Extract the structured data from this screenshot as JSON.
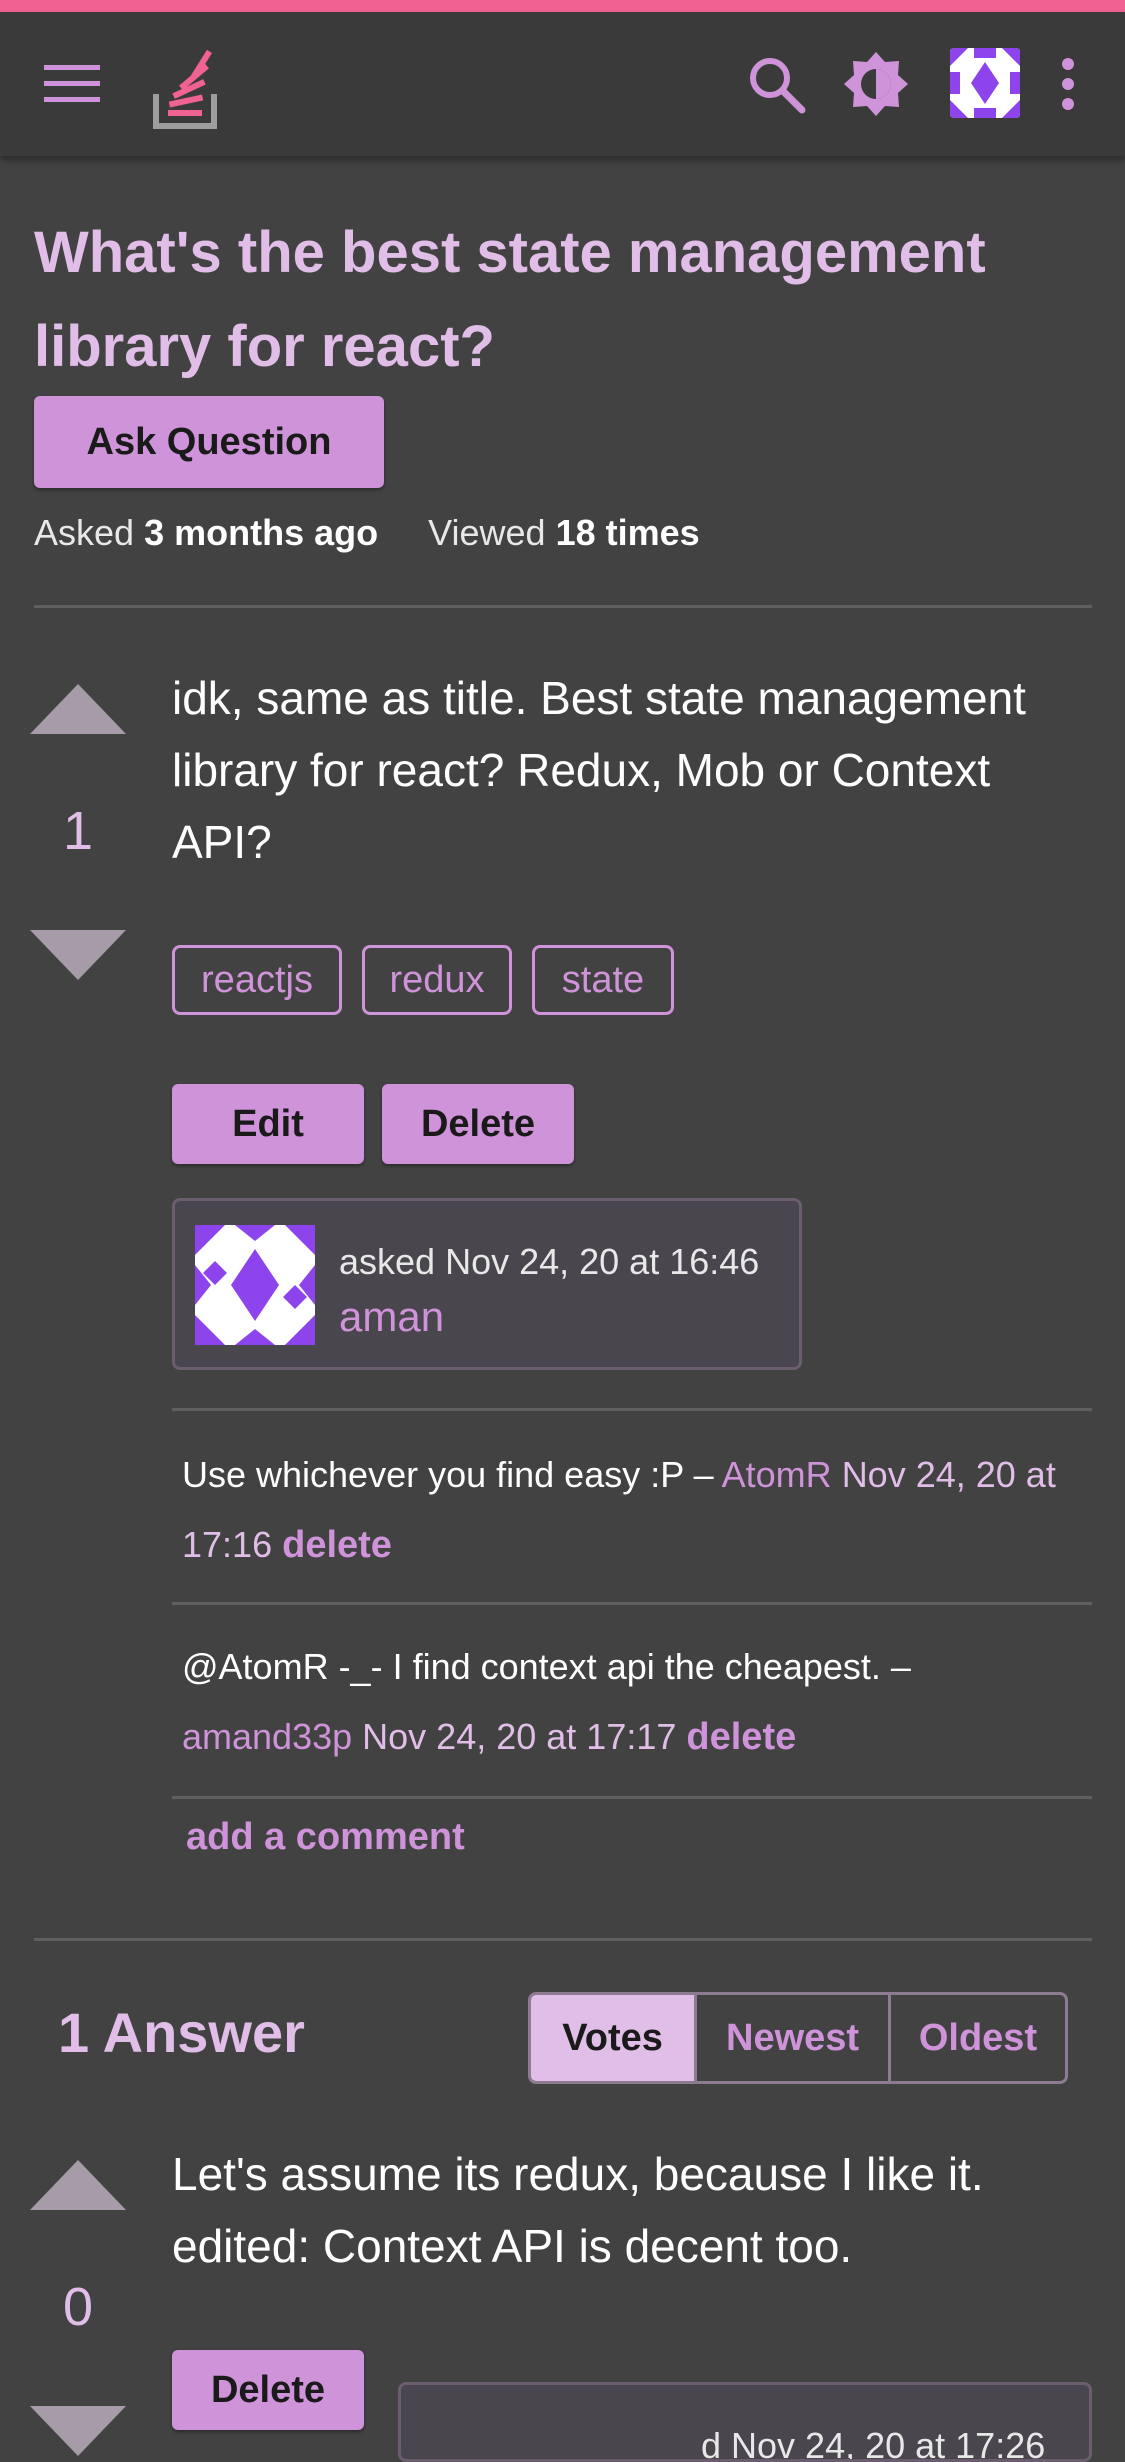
{
  "colors": {
    "accent_bar": "#f06292",
    "background": "#424242",
    "appbar": "#3a3a3a",
    "primary": "#ce93d8",
    "primary_light": "#e1bee7",
    "vote_arrow": "#a79aa9"
  },
  "appbar": {
    "icons": [
      "menu-icon",
      "stackoverflow-logo",
      "search-icon",
      "theme-toggle-icon",
      "user-avatar",
      "more-vert-icon"
    ]
  },
  "question": {
    "title": "What's the best state management library for react?",
    "ask_button": "Ask Question",
    "asked_label": "Asked",
    "asked_value": "3 months ago",
    "viewed_label": "Viewed",
    "viewed_value": "18 times",
    "votes": "1",
    "body": "idk, same as title. Best state management library for react? Redux, Mob or Context API?",
    "tags": [
      "reactjs",
      "redux",
      "state"
    ],
    "edit_label": "Edit",
    "delete_label": "Delete",
    "asked_line": "asked Nov 24, 20 at 16:46",
    "author": "aman"
  },
  "comments": [
    {
      "text": "Use whichever you find easy :P – ",
      "user": "AtomR",
      "date": "Nov 24, 20 at 17:16",
      "delete": "delete"
    },
    {
      "text": "@AtomR -_- I find context api the cheapest. – ",
      "user": "amand33p",
      "date": "Nov 24, 20 at 17:17",
      "delete": "delete"
    }
  ],
  "add_comment": "add a comment",
  "answers": {
    "heading": "1 Answer",
    "sort": [
      "Votes",
      "Newest",
      "Oldest"
    ],
    "active_sort": "Votes",
    "items": [
      {
        "votes": "0",
        "body": "Let's assume its redux, because I like it. edited: Context API is decent too.",
        "delete_label": "Delete",
        "partial_line": "d Nov 24, 20 at 17:26"
      }
    ]
  }
}
